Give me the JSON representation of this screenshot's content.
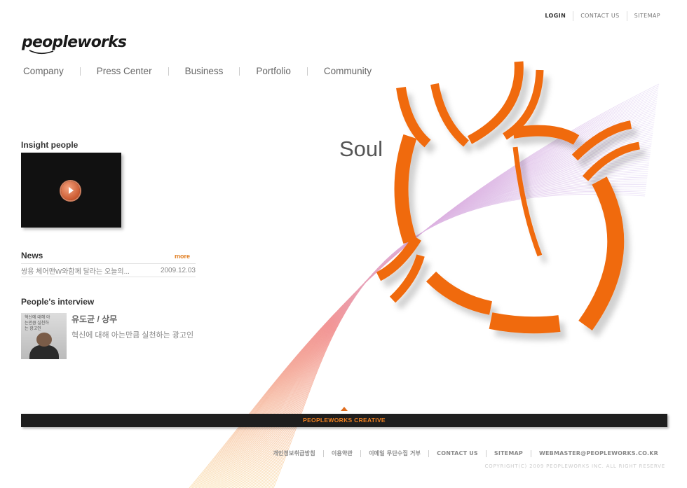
{
  "utility": {
    "login": "LOGIN",
    "contact": "CONTACT US",
    "sitemap": "SITEMAP"
  },
  "logo": {
    "text": "peopleworks"
  },
  "nav": [
    "Company",
    "Press Center",
    "Business",
    "Portfolio",
    "Community"
  ],
  "hero": {
    "word": "Soul"
  },
  "insight": {
    "title": "Insight people"
  },
  "news": {
    "title": "News",
    "more": "more",
    "item_title": "쌍용 체어맨W와함께 달라는 오늘의...",
    "item_date": "2009.12.03"
  },
  "interview": {
    "title": "People's interview",
    "name": "유도균 / 상무",
    "desc": "혁신에 대해 아는만큼 실천하는 광고인",
    "image_caption": "혁신에 대해 아는만큼 실천하는 광고인"
  },
  "bar": {
    "label": "PEOPLEWORKS CREATIVE"
  },
  "footer": {
    "links": [
      "개인정보취급방침",
      "이용약관",
      "이메일 무단수집 거부",
      "CONTACT US",
      "SITEMAP",
      "WEBMASTER@PEOPLEWORKS.CO.KR"
    ],
    "copyright": "COPYRIGHT(C) 2009 PEOPLEWORKS INC. ALL RIGHT RESERVE"
  },
  "colors": {
    "accent": "#f06a10",
    "bar": "#1e1e1e",
    "more": "#e07a1a"
  }
}
